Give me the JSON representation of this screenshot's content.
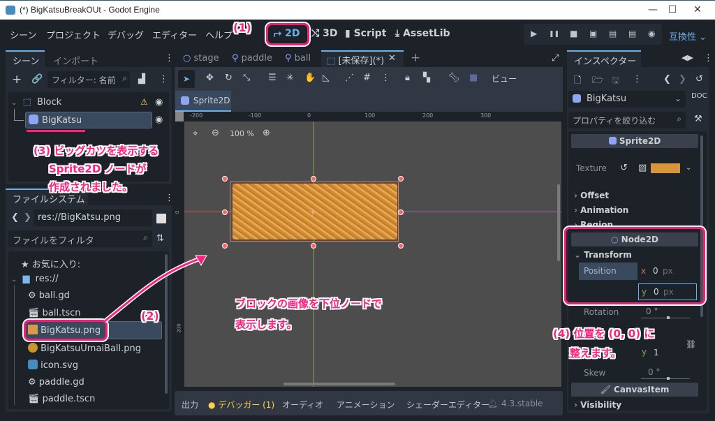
{
  "window": {
    "title": "(*) BigKatsuBreakOUt - Godot Engine",
    "minimize": "—",
    "maximize": "☐",
    "close": "✕"
  },
  "menu": [
    "シーン",
    "プロジェクト",
    "デバッグ",
    "エディター",
    "ヘルプ"
  ],
  "modes": [
    {
      "label": "2D",
      "icon": "⮣",
      "active": true
    },
    {
      "label": "3D",
      "icon": "⤭"
    },
    {
      "label": "Script",
      "icon": "▮"
    },
    {
      "label": "AssetLib",
      "icon": "⤓"
    }
  ],
  "run_controls": [
    "▶",
    "❚❚",
    "■",
    "▣",
    "▤",
    "▤",
    "◉"
  ],
  "compat": "互換性 ⌄",
  "scene_dock": {
    "tabs": [
      "シーン",
      "インポート"
    ],
    "filter_placeholder": "フィルター: 名前",
    "tree": [
      {
        "name": "Block",
        "warning": true
      },
      {
        "name": "BigKatsu",
        "selected": true
      }
    ]
  },
  "filesystem_dock": {
    "tab": "ファイルシステム",
    "path": "res://BigKatsu.png",
    "filter_placeholder": "ファイルをフィルタ",
    "favorites": "お気に入り:",
    "root": "res://",
    "files": [
      {
        "name": "ball.gd",
        "icon": "gear"
      },
      {
        "name": "ball.tscn",
        "icon": "clapper"
      },
      {
        "name": "BigKatsu.png",
        "icon": "image",
        "selected": true
      },
      {
        "name": "BigKatsuUmaiBall.png",
        "icon": "image"
      },
      {
        "name": "icon.svg",
        "icon": "godot"
      },
      {
        "name": "paddle.gd",
        "icon": "gear"
      },
      {
        "name": "paddle.tscn",
        "icon": "clapper"
      }
    ]
  },
  "editor_tabs": [
    {
      "label": "stage",
      "icon": "○"
    },
    {
      "label": "paddle",
      "icon": "⚲"
    },
    {
      "label": "ball",
      "icon": "⚲"
    },
    {
      "label": "[未保存](*)",
      "icon": "⬚",
      "active": true
    }
  ],
  "toolbar": {
    "view": "ビュー"
  },
  "sprite_tab": "Sprite2D",
  "viewport": {
    "zoom": "100 %",
    "ruler_x": [
      "-200",
      "-100",
      "0",
      "100",
      "200",
      "300"
    ],
    "ruler_y": [
      "0",
      "200"
    ]
  },
  "bottom_tabs": [
    "出力",
    "デバッガー (1)",
    "オーディオ",
    "アニメーション",
    "シェーダーエディター"
  ],
  "version": "4.3.stable",
  "inspector": {
    "tab": "インスペクター",
    "node": "BigKatsu",
    "filter_placeholder": "プロパティを絞り込む",
    "section_sprite": "Sprite2D",
    "texture_label": "Texture",
    "groups1": [
      "Offset",
      "Animation",
      "Region"
    ],
    "section_node2d": "Node2D",
    "transform": "Transform",
    "position_label": "Position",
    "pos_x": "0",
    "pos_y": "0",
    "unit": "px",
    "rotation_label": "Rotation",
    "rotation": "0 °",
    "scale_y": "1",
    "skew_label": "Skew",
    "skew": "0 °",
    "section_canvas": "CanvasItem",
    "visibility": "Visibility"
  },
  "annotations": {
    "a1": "(1)",
    "a2": "(2)",
    "a3_line1": "(3) ビッグカツを表示する",
    "a3_line2": "Sprite2D ノードが",
    "a3_line3": "作成されました。",
    "center_line1": "ブロックの画像を下位ノードで",
    "center_line2": "表示します。",
    "a4_line1": "(4) 位置を (0, 0) に",
    "a4_line2": "整えます。"
  }
}
